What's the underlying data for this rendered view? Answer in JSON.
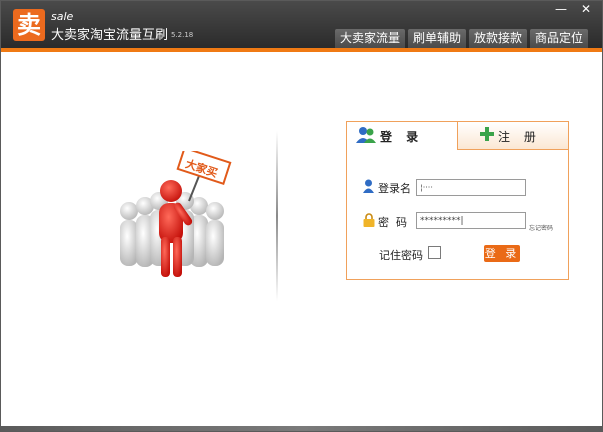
{
  "app": {
    "logo_char": "卖",
    "subtitle": "sale",
    "title": "大卖家淘宝流量互刷",
    "version": "5.2.18"
  },
  "window_controls": {
    "minimize": "—",
    "close": "✕"
  },
  "nav_tabs": [
    "大卖家流量",
    "刷单辅助",
    "放款接款",
    "商品定位"
  ],
  "illustration": {
    "sign_text": "大家买"
  },
  "login_panel": {
    "tab_login": "登 录",
    "tab_register": "注 册",
    "username_label": "登录名",
    "username_value": "¦····",
    "password_label": "密  码",
    "password_value": "*********|",
    "forgot_link": "忘记密码",
    "remember_label": "记住密码",
    "login_button": "登 录"
  },
  "colors": {
    "accent": "#ec6a1e",
    "panel_border": "#f0a15b",
    "titlebar": "#333333"
  },
  "icons": [
    "user-group-icon",
    "plus-icon",
    "user-icon",
    "lock-icon"
  ]
}
